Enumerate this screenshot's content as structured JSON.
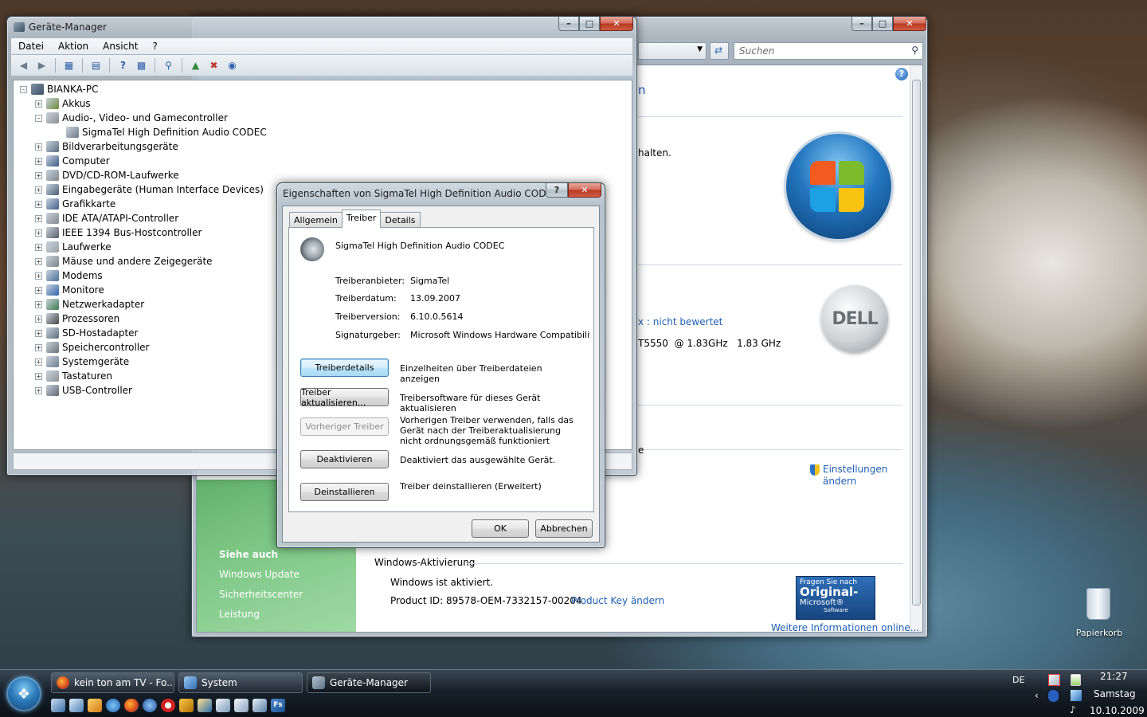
{
  "desktop": {
    "recycle_bin_label": "Papierkorb"
  },
  "system_window": {
    "search_placeholder": "Suchen",
    "heading_partial": "n",
    "partial_text": "halten.",
    "rating_link": "x : nicht bewertet",
    "processor_text": "T5550  @ 1.83GHz   1.83 GHz",
    "partial_e": "e",
    "settings_link": "Einstellungen ändern",
    "see_also": {
      "heading": "Siehe auch",
      "items": [
        "Windows Update",
        "Sicherheitscenter",
        "Leistung"
      ]
    },
    "activation": {
      "heading": "Windows-Aktivierung",
      "status": "Windows ist aktiviert.",
      "product_id": "Product ID: 89578-OEM-7332157-00204",
      "product_key_link": "Product Key ändern",
      "more_info_link": "Weitere Informationen online...",
      "badge_line1": "Fragen Sie nach",
      "badge_line2": "Original-",
      "badge_line3": "Microsoft®",
      "badge_line4": "Software"
    },
    "dell_logo": "DELL"
  },
  "device_manager": {
    "title": "Geräte-Manager",
    "menu": [
      "Datei",
      "Aktion",
      "Ansicht",
      "?"
    ],
    "root": "BIANKA-PC",
    "nodes": [
      "Akkus",
      "Audio-, Video- und Gamecontroller",
      "SigmaTel High Definition Audio CODEC",
      "Bildverarbeitungsgeräte",
      "Computer",
      "DVD/CD-ROM-Laufwerke",
      "Eingabegeräte (Human Interface Devices)",
      "Grafikkarte",
      "IDE ATA/ATAPI-Controller",
      "IEEE 1394 Bus-Hostcontroller",
      "Laufwerke",
      "Mäuse und andere Zeigegeräte",
      "Modems",
      "Monitore",
      "Netzwerkadapter",
      "Prozessoren",
      "SD-Hostadapter",
      "Speichercontroller",
      "Systemgeräte",
      "Tastaturen",
      "USB-Controller"
    ]
  },
  "properties_dialog": {
    "title": "Eigenschaften von SigmaTel High Definition Audio CODEC",
    "help_glyph": "?",
    "tabs": [
      "Allgemein",
      "Treiber",
      "Details"
    ],
    "active_tab": "Treiber",
    "device_name": "SigmaTel High Definition Audio CODEC",
    "fields": {
      "provider_label": "Treiberanbieter:",
      "provider_value": "SigmaTel",
      "date_label": "Treiberdatum:",
      "date_value": "13.09.2007",
      "version_label": "Treiberversion:",
      "version_value": "6.10.0.5614",
      "signer_label": "Signaturgeber:",
      "signer_value": "Microsoft Windows Hardware Compatibility Publi"
    },
    "actions": [
      {
        "label": "Treiberdetails",
        "desc": "Einzelheiten über Treiberdateien anzeigen"
      },
      {
        "label": "Treiber aktualisieren...",
        "desc": "Treibersoftware für dieses Gerät aktualisieren"
      },
      {
        "label": "Vorheriger Treiber",
        "desc": "Vorherigen Treiber verwenden, falls das Gerät nach der Treiberaktualisierung nicht ordnungsgemäß funktioniert"
      },
      {
        "label": "Deaktivieren",
        "desc": "Deaktiviert das ausgewählte Gerät."
      },
      {
        "label": "Deinstallieren",
        "desc": "Treiber deinstallieren (Erweitert)"
      }
    ],
    "ok_label": "OK",
    "cancel_label": "Abbrechen"
  },
  "taskbar": {
    "buttons": [
      "kein ton am TV - Fo...",
      "System",
      "Geräte-Manager"
    ],
    "language": "DE",
    "time": "21:27",
    "day": "Samstag",
    "date": "10.10.2009"
  },
  "colors": {
    "link": "#1f5fb5",
    "sidebar_green": "#7cc684",
    "taskbar_dark": "#0b1117"
  }
}
